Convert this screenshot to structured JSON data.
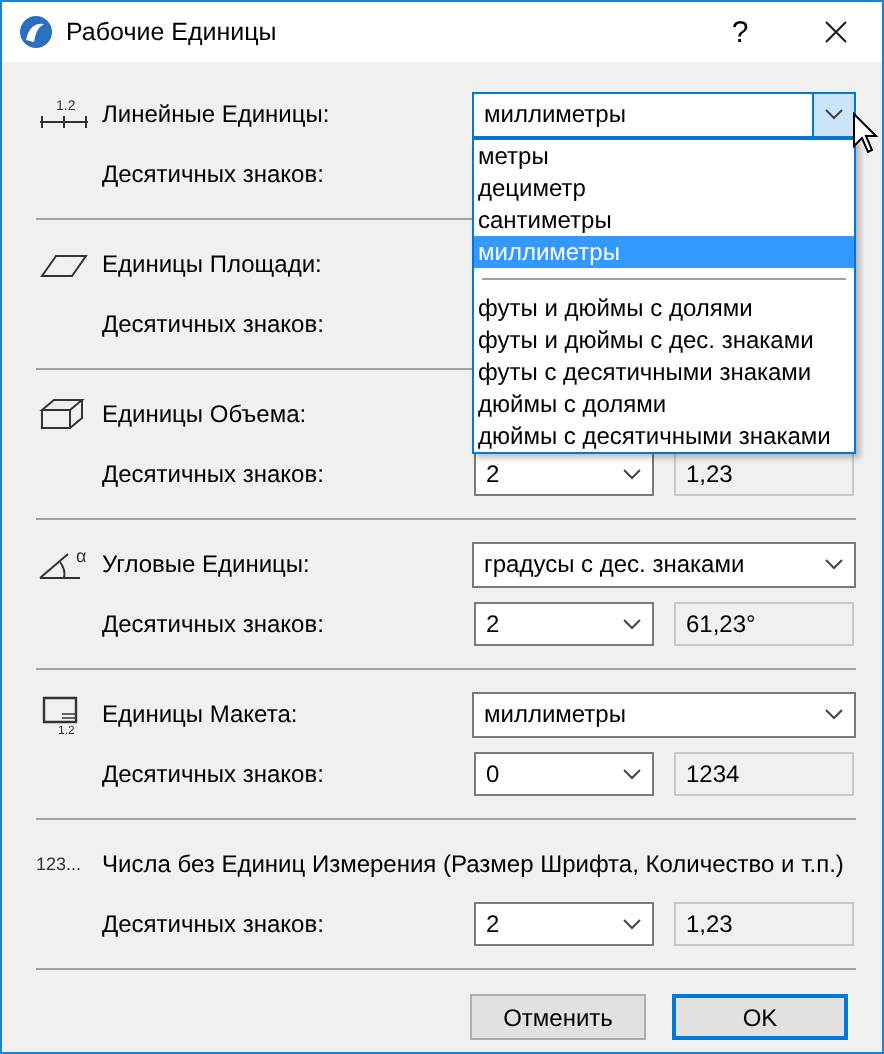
{
  "window": {
    "title": "Рабочие Единицы",
    "help": "?"
  },
  "sections": [
    {
      "icon_text": "1.2",
      "label": "Линейные Единицы:",
      "select": {
        "value": "миллиметры",
        "hover": true,
        "open": true,
        "options": [
          {
            "kind": "option",
            "label": "метры",
            "selected": false
          },
          {
            "kind": "option",
            "label": "дециметр",
            "selected": false
          },
          {
            "kind": "option",
            "label": "сантиметры",
            "selected": false
          },
          {
            "kind": "option",
            "label": "миллиметры",
            "selected": true
          },
          {
            "kind": "separator"
          },
          {
            "kind": "option",
            "label": "футы и дюймы с долями",
            "selected": false
          },
          {
            "kind": "option",
            "label": "футы и дюймы с дес. знаками",
            "selected": false
          },
          {
            "kind": "option",
            "label": "футы с десятичными знаками",
            "selected": false
          },
          {
            "kind": "option",
            "label": "дюймы с долями",
            "selected": false
          },
          {
            "kind": "option",
            "label": "дюймы с десятичными знаками",
            "selected": false
          }
        ]
      },
      "decimals_label": "Десятичных знаков:"
    },
    {
      "label": "Единицы Площади:",
      "decimals_label": "Десятичных знаков:"
    },
    {
      "label": "Единицы Объема:",
      "decimals_label": "Десятичных знаков:",
      "decimals": "2",
      "preview": "1,23"
    },
    {
      "icon_text": "α",
      "label": "Угловые Единицы:",
      "select": {
        "value": "градусы с дес. знаками",
        "hover": false
      },
      "decimals_label": "Десятичных знаков:",
      "decimals": "2",
      "preview": "61,23°"
    },
    {
      "icon_text": "1.2",
      "label": "Единицы Макета:",
      "select": {
        "value": "миллиметры",
        "hover": false
      },
      "decimals_label": "Десятичных знаков:",
      "decimals": "0",
      "preview": "1234"
    },
    {
      "icon_text": "123...",
      "label": "Числа без Единиц Измерения (Размер Шрифта, Количество и т.п.)",
      "decimals_label": "Десятичных знаков:",
      "decimals": "2",
      "preview": "1,23"
    }
  ],
  "buttons": [
    {
      "label": "Отменить",
      "default": false
    },
    {
      "label": "OK",
      "default": true
    }
  ]
}
